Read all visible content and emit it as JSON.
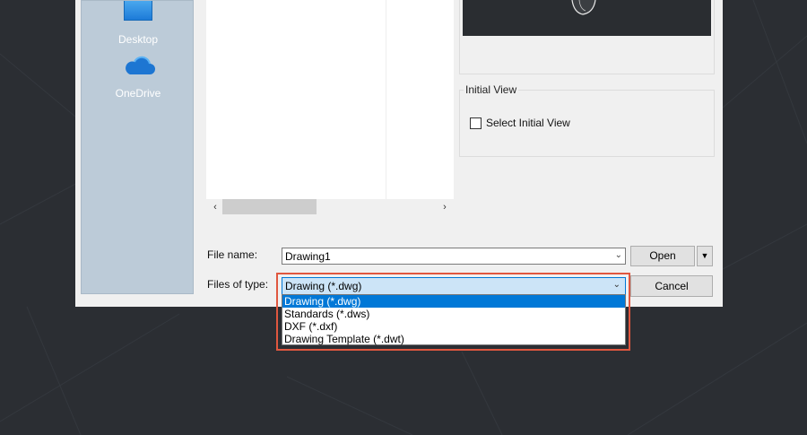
{
  "places": {
    "desktop_label": "Desktop",
    "onedrive_label": "OneDrive"
  },
  "initial_view": {
    "title": "Initial View",
    "checkbox_label": "Select Initial View",
    "checked": false
  },
  "file_name": {
    "label": "File name:",
    "value": "Drawing1"
  },
  "files_of_type": {
    "label": "Files of type:",
    "selected": "Drawing (*.dwg)",
    "options": [
      "Drawing (*.dwg)",
      "Standards (*.dws)",
      "DXF (*.dxf)",
      "Drawing Template (*.dwt)"
    ],
    "highlighted_index": 0
  },
  "buttons": {
    "open": "Open",
    "cancel": "Cancel"
  },
  "icons": {
    "scroll_left": "‹",
    "scroll_right": "›",
    "combo_arrow": "⌄",
    "split_arrow": "▼"
  },
  "colors": {
    "accent": "#0078d7",
    "highlight_border": "#e0573f",
    "background": "#2b2e33"
  }
}
